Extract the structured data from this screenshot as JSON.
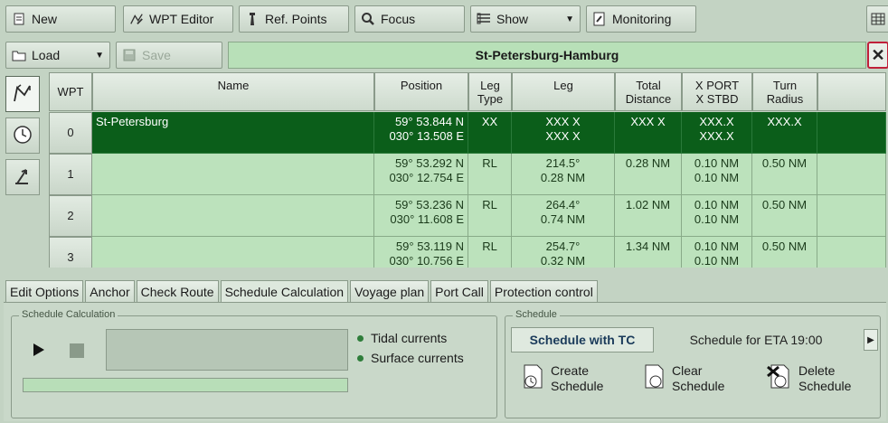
{
  "toolbar": {
    "new_label": "New",
    "wpt_editor_label": "WPT Editor",
    "ref_points_label": "Ref. Points",
    "focus_label": "Focus",
    "show_label": "Show",
    "monitoring_label": "Monitoring",
    "load_label": "Load",
    "save_label": "Save"
  },
  "route": {
    "title": "St-Petersburg-Hamburg",
    "close_glyph": "✕"
  },
  "table": {
    "headers": {
      "wpt": "WPT",
      "name": "Name",
      "position": "Position",
      "leg_type": "Leg\nType",
      "leg": "Leg",
      "total_distance": "Total\nDistance",
      "xport_xstbd": "X PORT\nX STBD",
      "turn_radius": "Turn\nRadius"
    },
    "rows": [
      {
        "wpt": "0",
        "name": "St-Petersburg",
        "position": "59° 53.844 N\n030° 13.508 E",
        "leg_type": "XX",
        "leg": "XXX X\nXXX X",
        "total_distance": "XXX X",
        "xport_xstbd": "XXX.X\nXXX.X",
        "turn_radius": "XXX.X"
      },
      {
        "wpt": "1",
        "name": "",
        "position": "59° 53.292 N\n030° 12.754 E",
        "leg_type": "RL",
        "leg": "214.5°\n0.28 NM",
        "total_distance": "0.28 NM",
        "xport_xstbd": "0.10 NM\n0.10 NM",
        "turn_radius": "0.50 NM"
      },
      {
        "wpt": "2",
        "name": "",
        "position": "59° 53.236 N\n030° 11.608 E",
        "leg_type": "RL",
        "leg": "264.4°\n0.74 NM",
        "total_distance": "1.02 NM",
        "xport_xstbd": "0.10 NM\n0.10 NM",
        "turn_radius": "0.50 NM"
      },
      {
        "wpt": "3",
        "name": "",
        "position": "59° 53.119 N\n030° 10.756 E",
        "leg_type": "RL",
        "leg": "254.7°\n0.32 NM",
        "total_distance": "1.34 NM",
        "xport_xstbd": "0.10 NM\n0.10 NM",
        "turn_radius": "0.50 NM"
      }
    ]
  },
  "tabs": [
    "Edit Options",
    "Anchor",
    "Check Route",
    "Schedule Calculation",
    "Voyage plan",
    "Port Call",
    "Protection control"
  ],
  "schedule_calc": {
    "group_title": "Schedule Calculation",
    "tidal_label": "Tidal currents",
    "surface_label": "Surface currents"
  },
  "schedule": {
    "group_title": "Schedule",
    "tab_with_tc": "Schedule with TC",
    "tab_eta": "Schedule for ETA 19:00",
    "create_label": "Create\nSchedule",
    "clear_label": "Clear\nSchedule",
    "delete_label": "Delete\nSchedule"
  },
  "colors": {
    "selected_row": "#0b5e1a",
    "row_bg": "#bce2bc",
    "panel_bg": "#c3d3c3",
    "close_border": "#c0203a"
  }
}
